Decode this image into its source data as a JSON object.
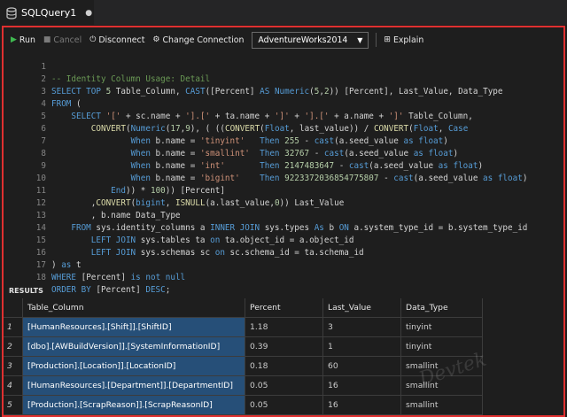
{
  "tab": {
    "title": "SQLQuery1",
    "dirty_marker": "●"
  },
  "toolbar": {
    "run": "Run",
    "cancel": "Cancel",
    "disconnect": "Disconnect",
    "change_connection": "Change Connection",
    "database": "AdventureWorks2014",
    "explain": "Explain"
  },
  "editor": {
    "line_numbers": [
      "1",
      "2",
      "3",
      "4",
      "5",
      "6",
      "7",
      "8",
      "9",
      "10",
      "11",
      "12",
      "13",
      "14",
      "15",
      "16",
      "17",
      "18"
    ]
  },
  "results": {
    "header": "RESULTS",
    "columns": [
      "Table_Column",
      "Percent",
      "Last_Value",
      "Data_Type"
    ],
    "rows": [
      {
        "num": "1",
        "table_column": "[HumanResources].[Shift]].[ShiftID]",
        "percent": "1.18",
        "last_value": "3",
        "data_type": "tinyint"
      },
      {
        "num": "2",
        "table_column": "[dbo].[AWBuildVersion]].[SystemInformationID]",
        "percent": "0.39",
        "last_value": "1",
        "data_type": "tinyint"
      },
      {
        "num": "3",
        "table_column": "[Production].[Location]].[LocationID]",
        "percent": "0.18",
        "last_value": "60",
        "data_type": "smallint"
      },
      {
        "num": "4",
        "table_column": "[HumanResources].[Department]].[DepartmentID]",
        "percent": "0.05",
        "last_value": "16",
        "data_type": "smallint"
      },
      {
        "num": "5",
        "table_column": "[Production].[ScrapReason]].[ScrapReasonID]",
        "percent": "0.05",
        "last_value": "16",
        "data_type": "smallint"
      }
    ]
  },
  "watermark": "Devtek"
}
